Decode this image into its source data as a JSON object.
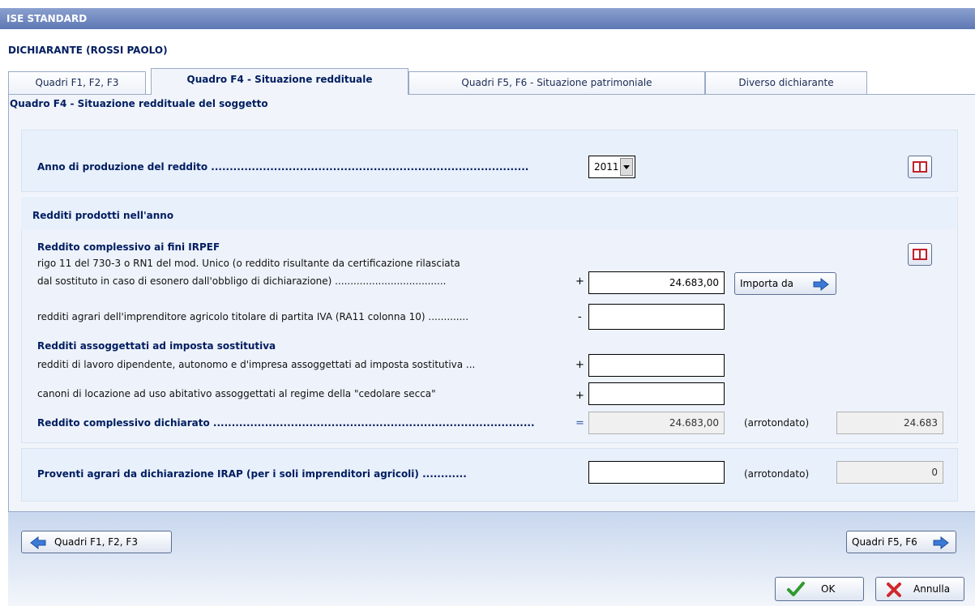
{
  "window": {
    "title": "ISE STANDARD"
  },
  "declarer": "DICHIARANTE (ROSSI PAOLO)",
  "tabs": [
    {
      "label": "Quadri F1, F2, F3"
    },
    {
      "label": "Quadro F4 - Situazione reddituale"
    },
    {
      "label": "Quadri F5, F6 - Situazione patrimoniale"
    },
    {
      "label": "Diverso dichiarante"
    }
  ],
  "subtitle": "Quadro F4 - Situazione reddituale del soggetto",
  "year": {
    "label": "Anno di produzione del reddito ......................................................................................",
    "value": "2011"
  },
  "redditi": {
    "header": "Redditi prodotti nell'anno",
    "irpef_title": "Reddito complessivo ai fini IRPEF",
    "irpef_line1": "rigo 11 del 730-3 o RN1 del mod. Unico (o reddito risultante da certificazione rilasciata",
    "irpef_line2": "dal sostituto in caso di esonero dall'obbligo di dichiarazione) ....................................",
    "irpef_sign": "+",
    "irpef_value": "24.683,00",
    "import_button": "Importa da",
    "agrari_label": "redditi agrari dell'imprenditore agricolo titolare di partita IVA (RA11 colonna 10) .............",
    "agrari_sign": "-",
    "agrari_value": "",
    "sostitutiva_title": "Redditi assoggettati ad imposta sostitutiva",
    "lavoro_label": "redditi di lavoro dipendente, autonomo e d'impresa assoggettati ad imposta sostitutiva ...",
    "lavoro_sign": "+",
    "lavoro_value": "",
    "canoni_label": "canoni di locazione ad uso abitativo assoggettati al regime della \"cedolare secca\"",
    "canoni_sign": "+",
    "canoni_value": "",
    "totale_label": "Reddito complessivo dichiarato .......................................................................................",
    "totale_sign": "=",
    "totale_value": "24.683,00",
    "arrotondato_label": "(arrotondato)",
    "totale_arrotondato": "24.683"
  },
  "irap": {
    "label": "Proventi agrari da dichiarazione IRAP (per i soli imprenditori agricoli) ............",
    "value": "",
    "arrotondato_label": "(arrotondato)",
    "arrotondato_value": "0"
  },
  "footer": {
    "prev_button": "Quadri F1, F2, F3",
    "next_button": "Quadri F5, F6",
    "ok_button": "OK",
    "cancel_button": "Annulla"
  }
}
